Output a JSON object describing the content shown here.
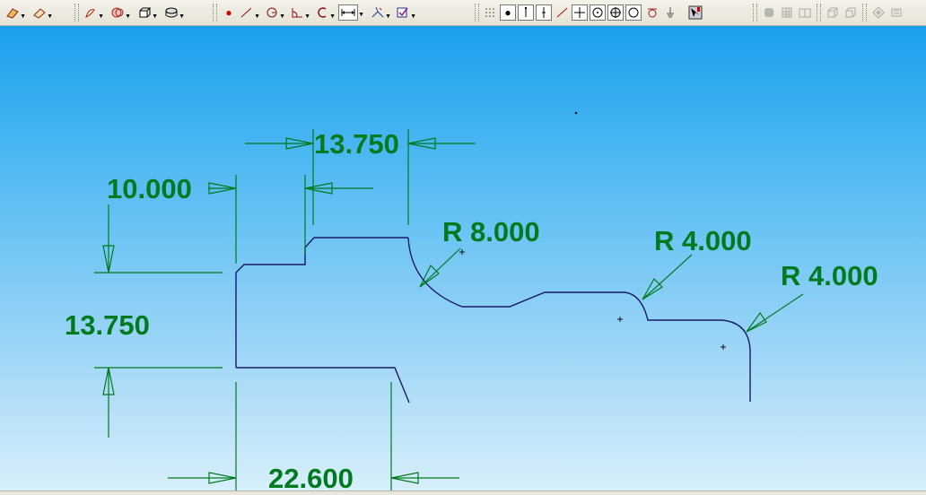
{
  "toolbar": {
    "groups": [
      {
        "name": "part-ops",
        "icons": [
          "rib-icon",
          "pocket-icon"
        ]
      },
      {
        "name": "sketch-ops",
        "icons": [
          "sketch-icon",
          "boolean-icon",
          "solid-icon",
          "surface-icon"
        ]
      },
      {
        "name": "draw",
        "icons": [
          "point-icon",
          "line-icon",
          "circle-icon",
          "corner-icon",
          "arc-icon",
          "dimension-icon",
          "constraint-icon",
          "check-icon"
        ]
      },
      {
        "name": "snap",
        "icons": [
          "grid-snap-icon",
          "snap-end-icon",
          "snap-vertical-icon",
          "snap-parallel-icon",
          "snap-perpendicular-icon",
          "snap-center-icon",
          "snap-crosshair-icon",
          "snap-circle-icon",
          "snap-tangent-icon",
          "snap-ground-icon",
          "render-mode-icon"
        ]
      },
      {
        "name": "views",
        "icons": [
          "shaded-view-icon",
          "wireframe-view-icon",
          "hidden-line-view-icon",
          "iso-view-icon",
          "front-view-icon",
          "light-icon",
          "settings-icon"
        ]
      }
    ]
  },
  "drawing": {
    "colors": {
      "dimension": "#007a1e",
      "geometry": "#1a1a66",
      "canvas_top": "#1aa0ee",
      "canvas_bottom": "#d8effb"
    },
    "dimensions": [
      {
        "id": "dim-top-width",
        "text": "13.750"
      },
      {
        "id": "dim-left-width",
        "text": "10.000"
      },
      {
        "id": "dim-left-height",
        "text": "13.750"
      },
      {
        "id": "dim-bottom-width",
        "text": "22.600"
      },
      {
        "id": "dim-radius-large",
        "text": "R 8.000"
      },
      {
        "id": "dim-radius-mid",
        "text": "R 4.000"
      },
      {
        "id": "dim-radius-right",
        "text": "R 4.000"
      }
    ]
  }
}
